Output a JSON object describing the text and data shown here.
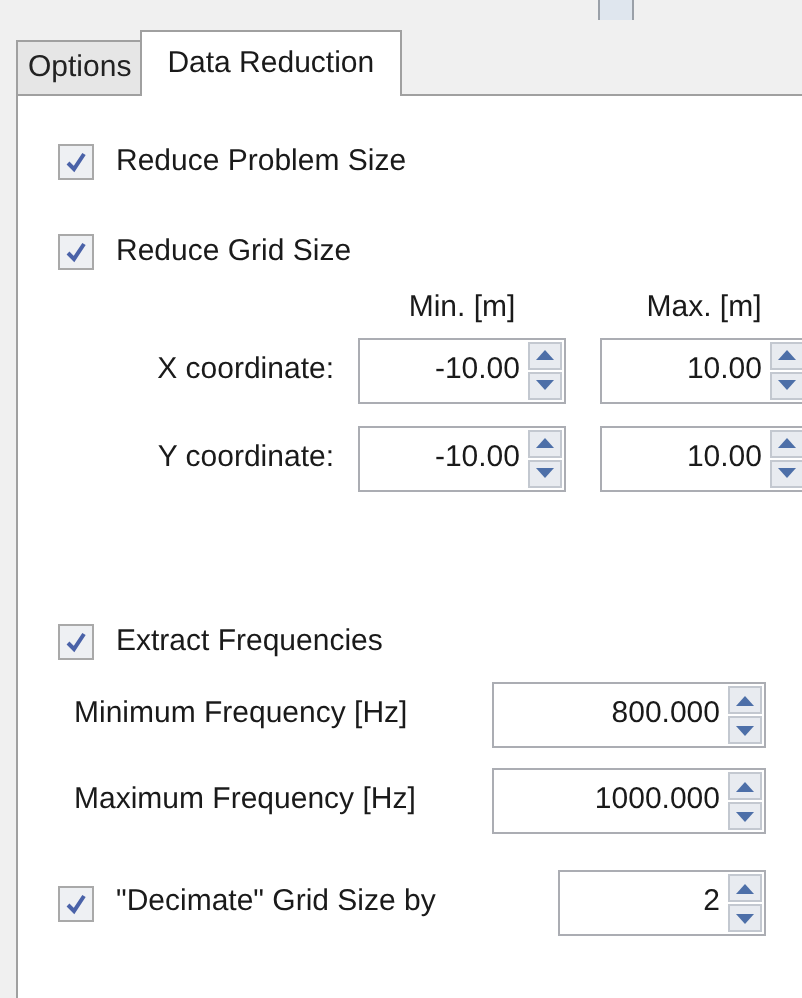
{
  "tabs": [
    {
      "label": "Options",
      "selected": false
    },
    {
      "label": "Data Reduction",
      "selected": true
    }
  ],
  "reduce_problem_size": {
    "label": "Reduce Problem Size",
    "checked": true
  },
  "reduce_grid_size": {
    "label": "Reduce Grid Size",
    "checked": true
  },
  "grid": {
    "columns": [
      "Min. [m]",
      "Max. [m]"
    ],
    "rows": [
      {
        "label": "X coordinate:",
        "min": "-10.00",
        "max": "10.00"
      },
      {
        "label": "Y coordinate:",
        "min": "-10.00",
        "max": "10.00"
      }
    ]
  },
  "extract_frequencies": {
    "label": "Extract Frequencies",
    "checked": true
  },
  "frequencies": [
    {
      "label": "Minimum Frequency [Hz]",
      "value": "800.000"
    },
    {
      "label": "Maximum Frequency [Hz]",
      "value": "1000.000"
    }
  ],
  "decimate": {
    "label": "\"Decimate\" Grid Size by",
    "checked": true,
    "value": "2"
  }
}
